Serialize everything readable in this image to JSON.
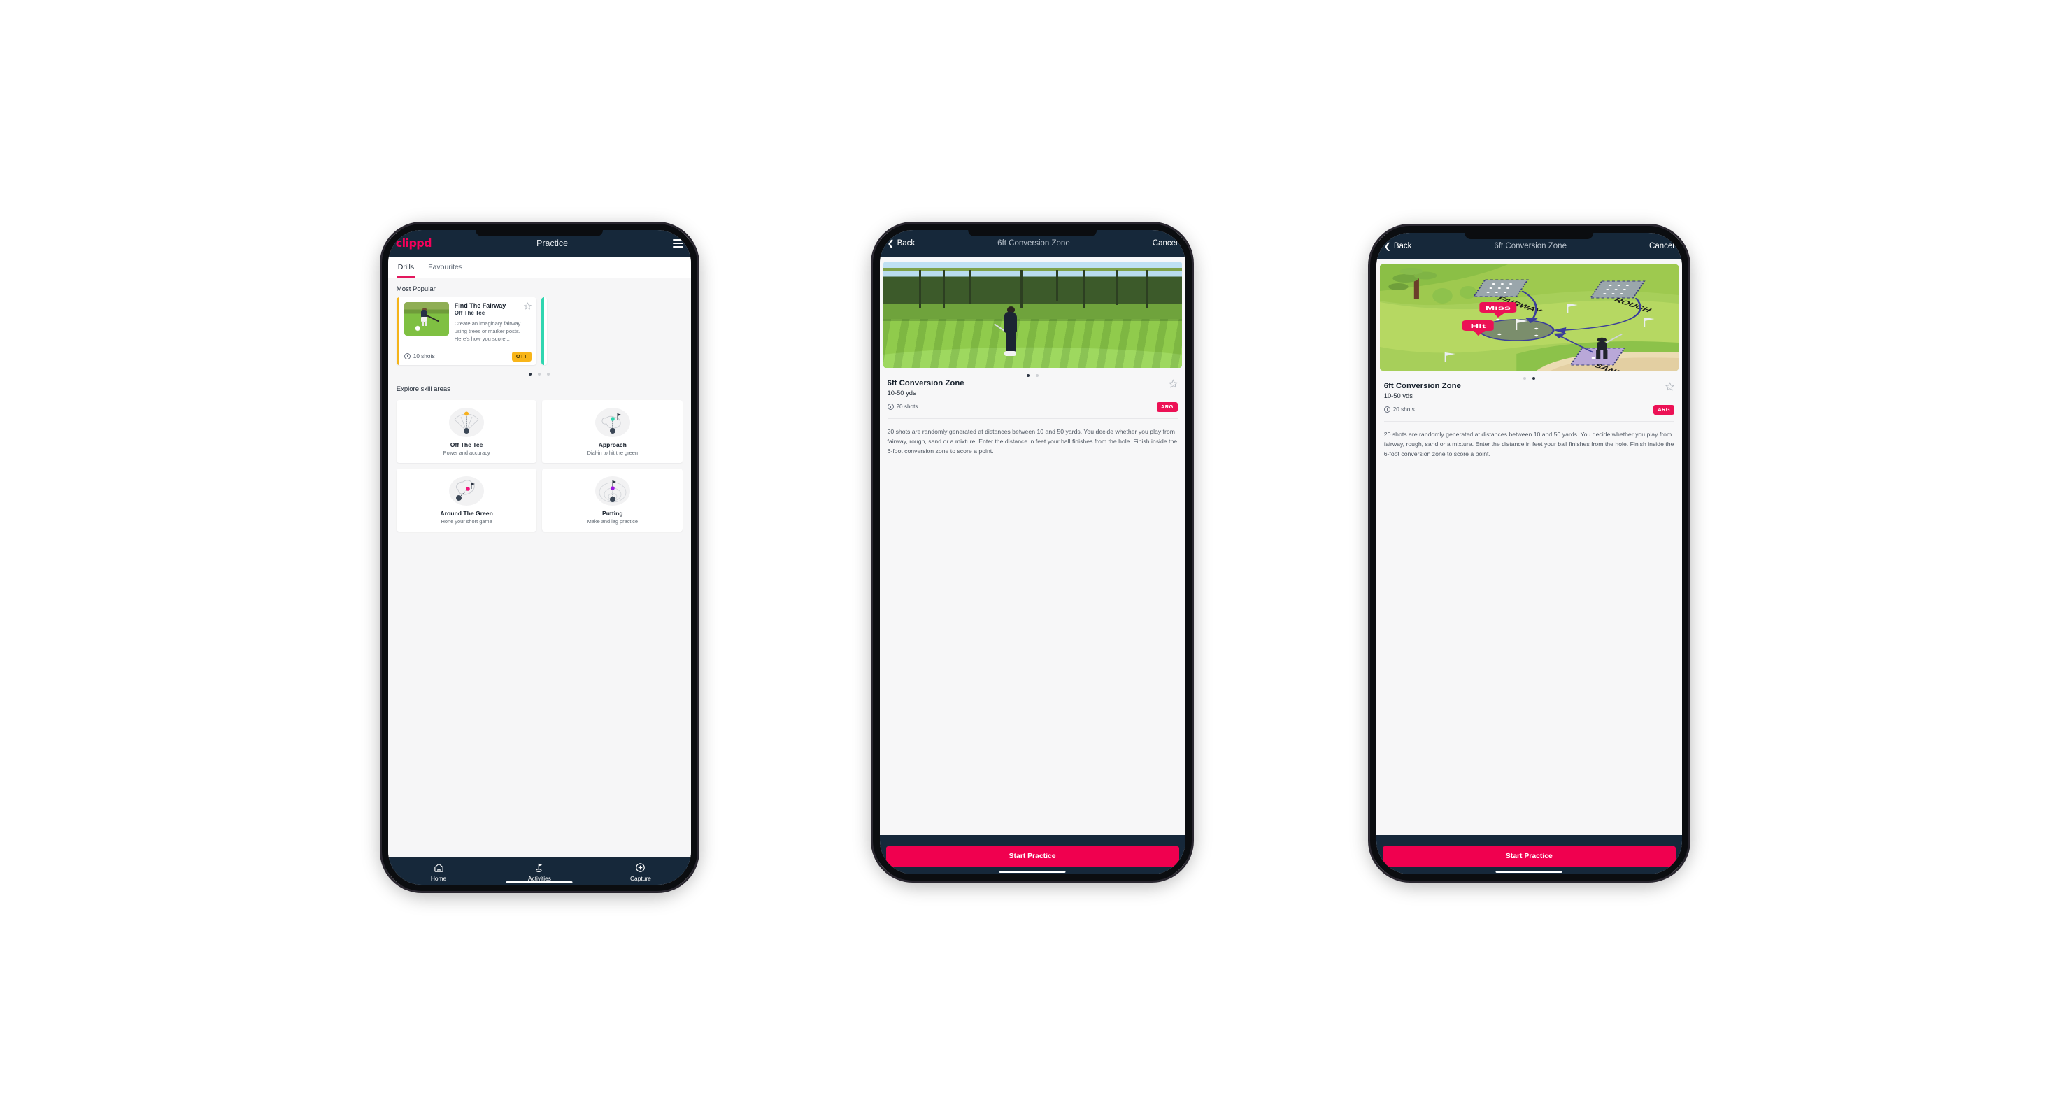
{
  "theme": {
    "brand_pink": "#f5005a",
    "nav_dark": "#16283a",
    "badge_ott": "#f8b519",
    "badge_arg": "#ec1155",
    "accent_yellow": "#f4b41a",
    "accent_teal": "#2fd6b0",
    "cta_pink": "#f0004f"
  },
  "phone1": {
    "appbar": {
      "logo": "clippd",
      "title": "Practice",
      "menu_icon": "hamburger-menu-icon"
    },
    "tabs": [
      {
        "label": "Drills",
        "active": true
      },
      {
        "label": "Favourites",
        "active": false
      }
    ],
    "most_popular": {
      "section_label": "Most Popular",
      "card": {
        "title": "Find The Fairway",
        "subtitle": "Off The Tee",
        "description": "Create an imaginary fairway using trees or marker posts. Here's how you score...",
        "shots": "10 shots",
        "badge": "OTT",
        "favourite_icon": "star-outline-icon",
        "shots_icon": "clock-icon"
      },
      "dots": [
        {
          "active": true
        },
        {
          "active": false
        },
        {
          "active": false
        }
      ]
    },
    "skill_areas": {
      "section_label": "Explore skill areas",
      "items": [
        {
          "name": "Off The Tee",
          "desc": "Power and accuracy",
          "icon": "tee-dispersion-icon"
        },
        {
          "name": "Approach",
          "desc": "Dial-in to hit the green",
          "icon": "approach-green-icon"
        },
        {
          "name": "Around The Green",
          "desc": "Hone your short game",
          "icon": "chip-green-icon"
        },
        {
          "name": "Putting",
          "desc": "Make and lag practice",
          "icon": "putting-rings-icon"
        }
      ]
    },
    "tabbar": [
      {
        "label": "Home",
        "icon": "home-icon",
        "active": false
      },
      {
        "label": "Activities",
        "icon": "golf-flag-icon",
        "active": true
      },
      {
        "label": "Capture",
        "icon": "plus-circle-icon",
        "active": false
      }
    ]
  },
  "phone2": {
    "navbar": {
      "back_label": "Back",
      "back_icon": "chevron-left-icon",
      "title": "6ft Conversion Zone",
      "cancel_label": "Cancel"
    },
    "hero": {
      "type": "photo",
      "alt": "golfer-chipping-photo"
    },
    "dots": [
      {
        "active": true
      },
      {
        "active": false
      }
    ],
    "detail": {
      "title": "6ft Conversion Zone",
      "subtitle": "10-50 yds",
      "shots": "20 shots",
      "badge": "ARG",
      "favourite_icon": "star-outline-icon",
      "description": "20 shots are randomly generated at distances between 10 and 50 yards. You decide whether you play from fairway, rough, sand or a mixture. Enter the distance in feet your ball finishes from the hole. Finish inside the 6-foot conversion zone to score a point."
    },
    "cta": "Start Practice"
  },
  "phone3": {
    "navbar": {
      "back_label": "Back",
      "back_icon": "chevron-left-icon",
      "title": "6ft Conversion Zone",
      "cancel_label": "Cancel"
    },
    "hero": {
      "type": "illustration",
      "alt": "golf-course-diagram",
      "labels": {
        "fairway": "FAIRWAY",
        "rough": "ROUGH",
        "sand": "SAND",
        "miss": "Miss",
        "hit": "Hit"
      }
    },
    "dots": [
      {
        "active": false
      },
      {
        "active": true
      }
    ],
    "detail": {
      "title": "6ft Conversion Zone",
      "subtitle": "10-50 yds",
      "shots": "20 shots",
      "badge": "ARG",
      "favourite_icon": "star-outline-icon",
      "description": "20 shots are randomly generated at distances between 10 and 50 yards. You decide whether you play from fairway, rough, sand or a mixture. Enter the distance in feet your ball finishes from the hole. Finish inside the 6-foot conversion zone to score a point."
    },
    "cta": "Start Practice"
  }
}
